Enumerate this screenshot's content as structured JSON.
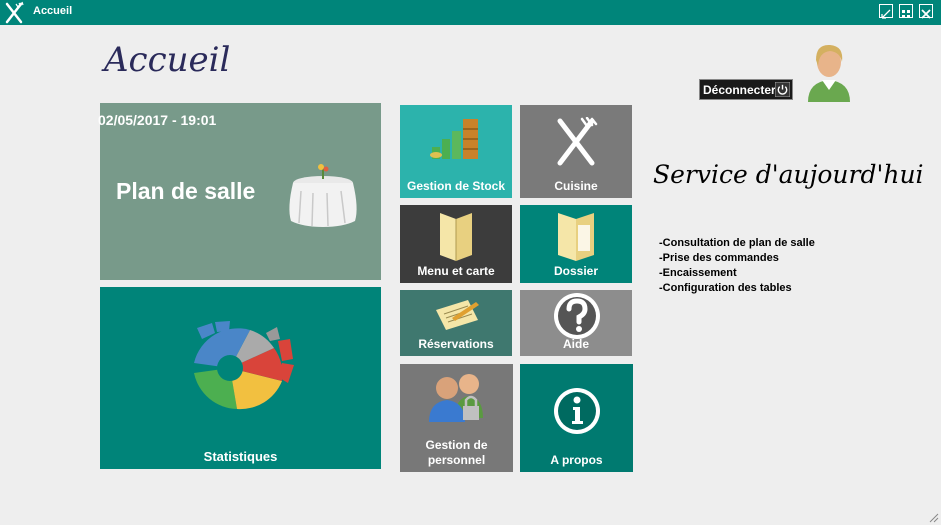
{
  "window": {
    "title": "Accueil",
    "controls": [
      "restore-icon",
      "maximize-icon",
      "close-icon"
    ]
  },
  "header": {
    "page_title": "Accueil",
    "logout_label": "Déconnecter"
  },
  "tiles": {
    "salle": {
      "datetime": "02/05/2017 - 19:01",
      "label": "Plan de salle"
    },
    "stats": {
      "label": "Statistiques"
    },
    "stock": {
      "label": "Gestion de Stock"
    },
    "cuisine": {
      "label": "Cuisine"
    },
    "menu": {
      "label": "Menu et carte"
    },
    "dossier": {
      "label": "Dossier"
    },
    "reservations": {
      "label": "Réservations"
    },
    "aide": {
      "label": "Aide"
    },
    "personnel": {
      "label": "Gestion de personnel"
    },
    "apropos": {
      "label": "A propos"
    }
  },
  "service": {
    "title": "Service d'aujourd'hui",
    "items": [
      "-Consultation de plan de salle",
      "-Prise des commandes",
      "-Encaissement",
      "-Configuration des tables"
    ]
  },
  "colors": {
    "titlebar": "#00857a",
    "teal": "#008479",
    "grey_green": "#789a8a"
  }
}
